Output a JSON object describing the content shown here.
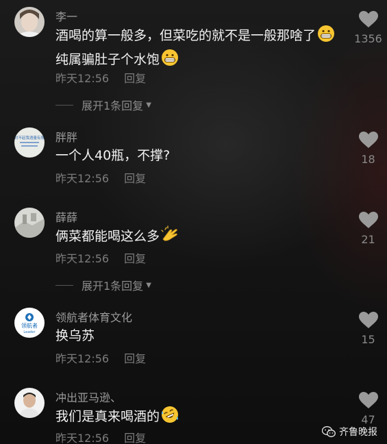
{
  "comments": [
    {
      "username": "李一",
      "text_part1": "酒喝的算一般多，但菜吃的就不是一般那啥了",
      "emoji1": "grin-emoji",
      "text_part2": "纯属骗肚子个水饱",
      "emoji2": "grin-emoji",
      "time": "昨天12:56",
      "reply_label": "回复",
      "likes": "1356",
      "expand_label": "展开1条回复"
    },
    {
      "username": "胖胖",
      "avatar_text": "对不起我酒量有限",
      "text": "一个人40瓶，不撑?",
      "time": "昨天12:56",
      "reply_label": "回复",
      "likes": "18"
    },
    {
      "username": "薛薛",
      "text": "俩菜都能喝这么多",
      "emoji": "clap-hand-emoji",
      "time": "昨天12:56",
      "reply_label": "回复",
      "likes": "21",
      "expand_label": "展开1条回复"
    },
    {
      "username": "领航者体育文化",
      "avatar_text_cn": "领航者",
      "avatar_text_en": "Leader",
      "text": "换乌苏",
      "time": "昨天12:56",
      "reply_label": "回复",
      "likes": "15"
    },
    {
      "username": "冲出亚马逊、",
      "text": "我们是真来喝酒的",
      "emoji": "rofl-emoji",
      "time": "昨天12:56",
      "reply_label": "回复",
      "likes": "47"
    }
  ],
  "watermark": "齐鲁晚报",
  "colors": {
    "primary_text": "#f2f2f2",
    "secondary_text": "#9b9b9b",
    "heart": "#9a9a9a",
    "emoji_yellow": "#f7c531"
  }
}
